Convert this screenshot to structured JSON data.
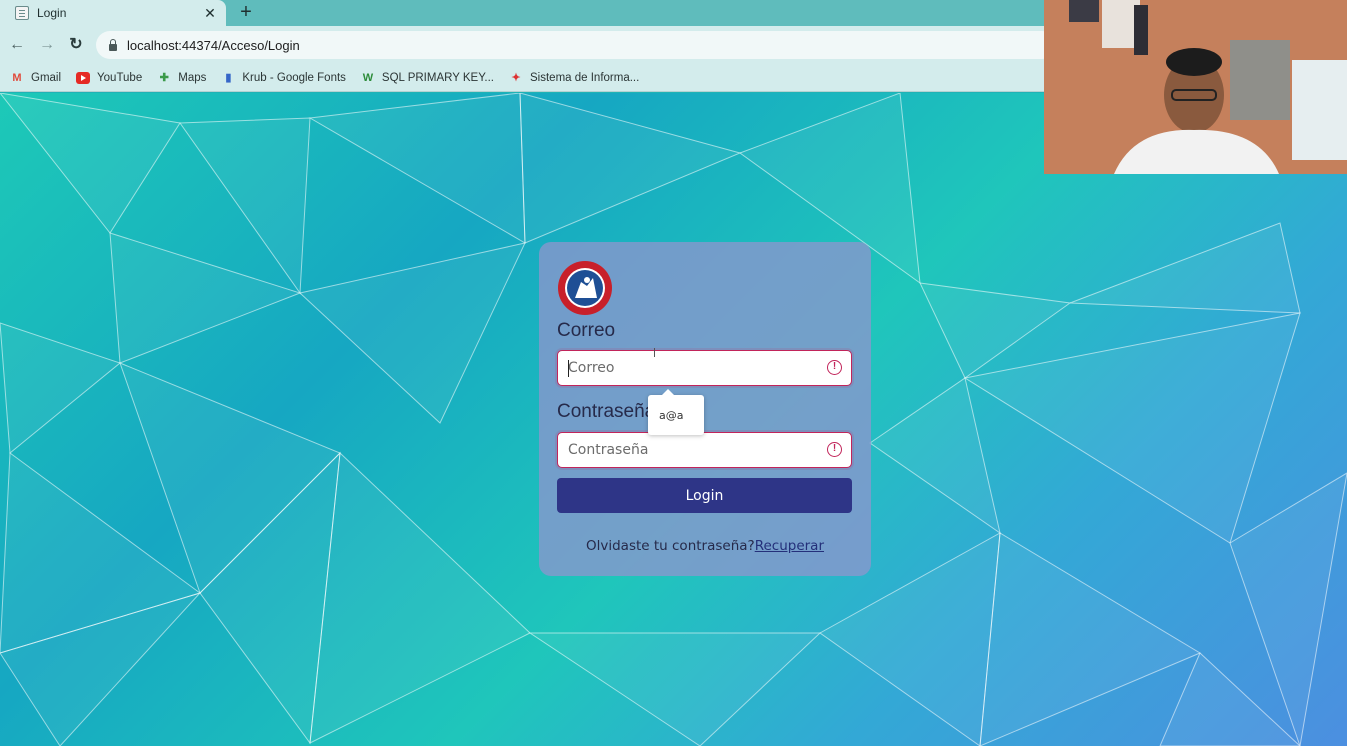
{
  "browser": {
    "tab_title": "Login",
    "tab_close": "✕",
    "new_tab": "+",
    "back": "←",
    "forward": "→",
    "reload": "↻",
    "url": "localhost:44374/Acceso/Login",
    "bookmarks": [
      {
        "label": "Gmail",
        "icon": "M"
      },
      {
        "label": "YouTube",
        "icon": ""
      },
      {
        "label": "Maps",
        "icon": "✚"
      },
      {
        "label": "Krub - Google Fonts",
        "icon": "▮"
      },
      {
        "label": "SQL PRIMARY KEY...",
        "icon": "W"
      },
      {
        "label": "Sistema de Informa...",
        "icon": "✦"
      }
    ]
  },
  "login": {
    "correo_label": "Correo",
    "correo_placeholder": "Correo",
    "password_label": "Contraseña",
    "password_placeholder": "Contraseña",
    "warning_glyph": "!",
    "login_button": "Login",
    "forgot_text": "Olvidaste tu contraseña?",
    "recover_link": "Recuperar",
    "autofill_suggestion": "a@a"
  },
  "colors": {
    "accent": "#2e3587",
    "error": "#c2245a",
    "card": "#8c96cd"
  }
}
